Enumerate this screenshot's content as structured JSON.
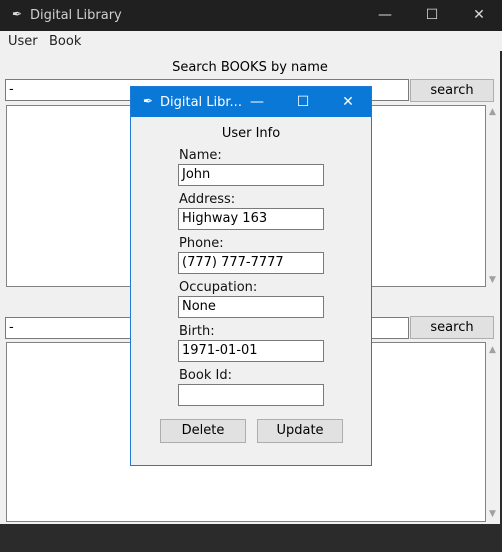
{
  "main_window": {
    "title": "Digital Library",
    "menu": [
      "User",
      "Book"
    ],
    "search_books_label": "Search BOOKS by name",
    "book_search_value": "-",
    "book_search_button": "search",
    "user_search_value": "-",
    "user_search_button": "search",
    "controls": {
      "minimize": "—",
      "maximize": "☐",
      "close": "✕"
    }
  },
  "dialog": {
    "title": "Digital Libr...",
    "heading": "User Info",
    "fields": [
      {
        "label": "Name:",
        "value": "John"
      },
      {
        "label": "Address:",
        "value": "Highway 163"
      },
      {
        "label": "Phone:",
        "value": "(777) 777-7777"
      },
      {
        "label": "Occupation:",
        "value": "None"
      },
      {
        "label": "Birth:",
        "value": "1971-01-01"
      },
      {
        "label": "Book Id:",
        "value": ""
      }
    ],
    "delete_label": "Delete",
    "update_label": "Update",
    "controls": {
      "minimize": "—",
      "maximize": "☐",
      "close": "✕"
    }
  },
  "icons": {
    "app_icon": "feather-icon",
    "scroll_up": "scroll-up-arrow-icon",
    "scroll_down": "scroll-down-arrow-icon"
  }
}
